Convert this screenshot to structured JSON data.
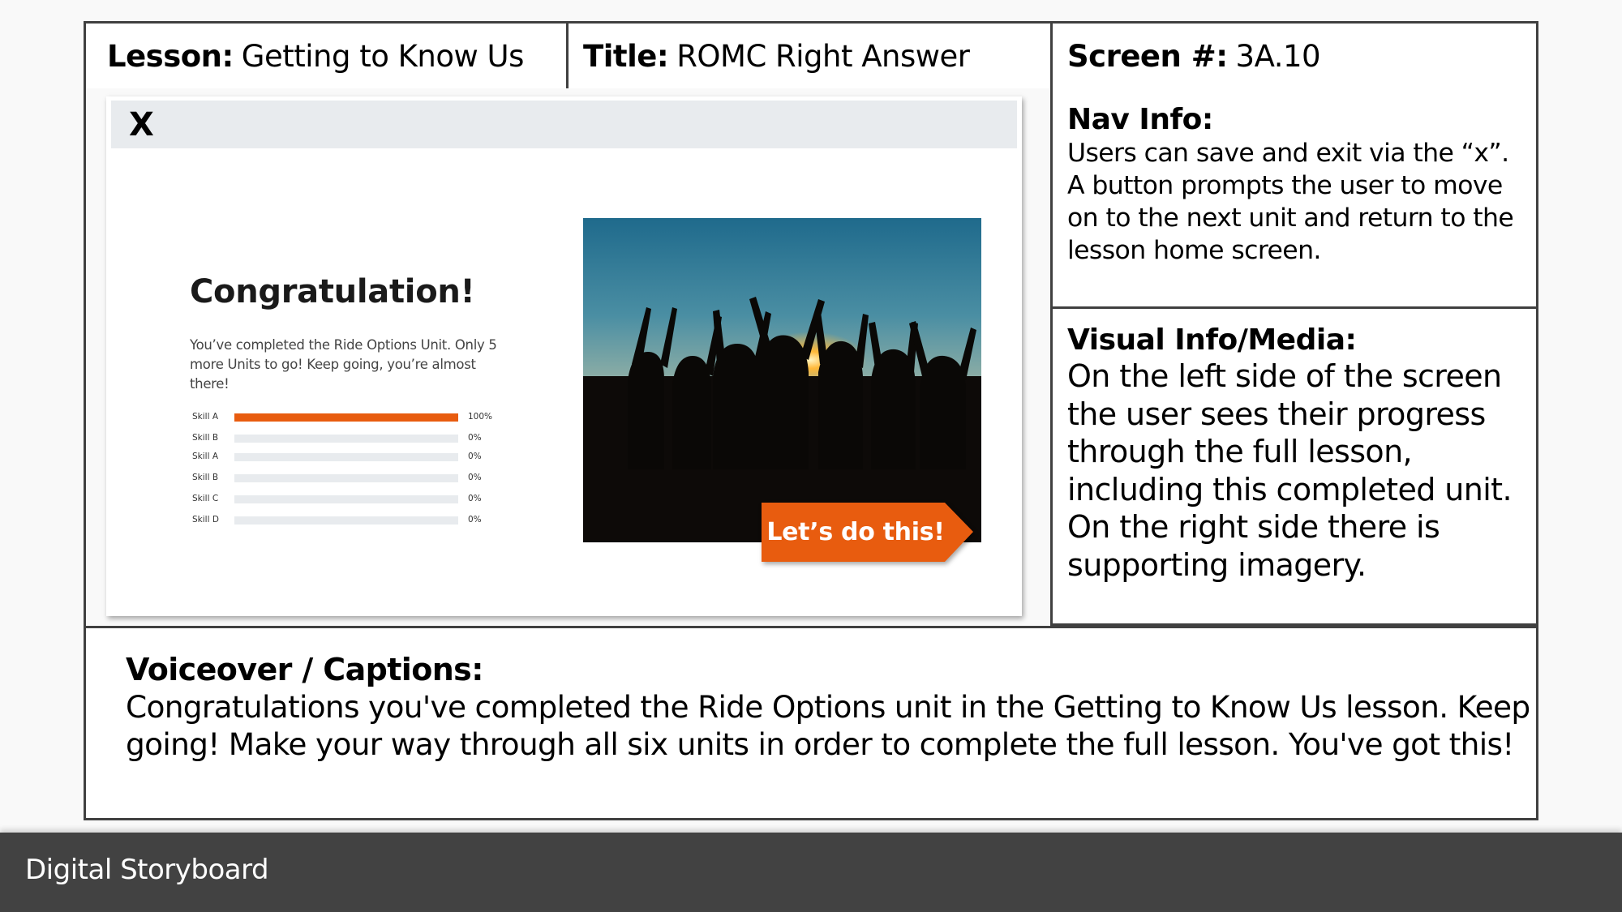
{
  "header": {
    "lesson_label": "Lesson:",
    "lesson_value": "Getting to Know Us",
    "title_label": "Title:",
    "title_value": "ROMC Right Answer",
    "screen_label": "Screen #:",
    "screen_value": "3A.10"
  },
  "mockup": {
    "close_label": "X",
    "heading": "Congratulation!",
    "message": "You’ve completed the Ride Options Unit. Only 5 more Units to go! Keep going, you’re almost there!",
    "skills": [
      {
        "label": "Skill A",
        "progress_percent": 100,
        "value_label": "100%"
      },
      {
        "label": "Skill B",
        "progress_percent": 0,
        "value_label": "0%"
      },
      {
        "label": "Skill A",
        "progress_percent": 0,
        "value_label": "0%"
      },
      {
        "label": "Skill B",
        "progress_percent": 0,
        "value_label": "0%"
      },
      {
        "label": "Skill C",
        "progress_percent": 0,
        "value_label": "0%"
      },
      {
        "label": "Skill D",
        "progress_percent": 0,
        "value_label": "0%"
      }
    ],
    "image_description": "silhouettes of people with raised arms at sunset",
    "cta_label": "Let’s do this!",
    "accent_color": "#e85c0f"
  },
  "nav_info": {
    "title": "Nav Info:",
    "text": "Users can save and exit via the “x”. A button prompts the user to move on to the next unit and return to the lesson home screen."
  },
  "visual_info": {
    "title": "Visual Info/Media:",
    "text": "On the left side of the screen the user sees their progress through the full lesson, including this completed unit. On the right side there is supporting imagery."
  },
  "captions": {
    "title": "Voiceover / Captions:",
    "text": "Congratulations you've completed the Ride Options unit in the Getting to Know Us lesson. Keep going! Make your way through all six units in order to complete the full lesson. You've got this!"
  },
  "footer": {
    "label": "Digital Storyboard"
  }
}
